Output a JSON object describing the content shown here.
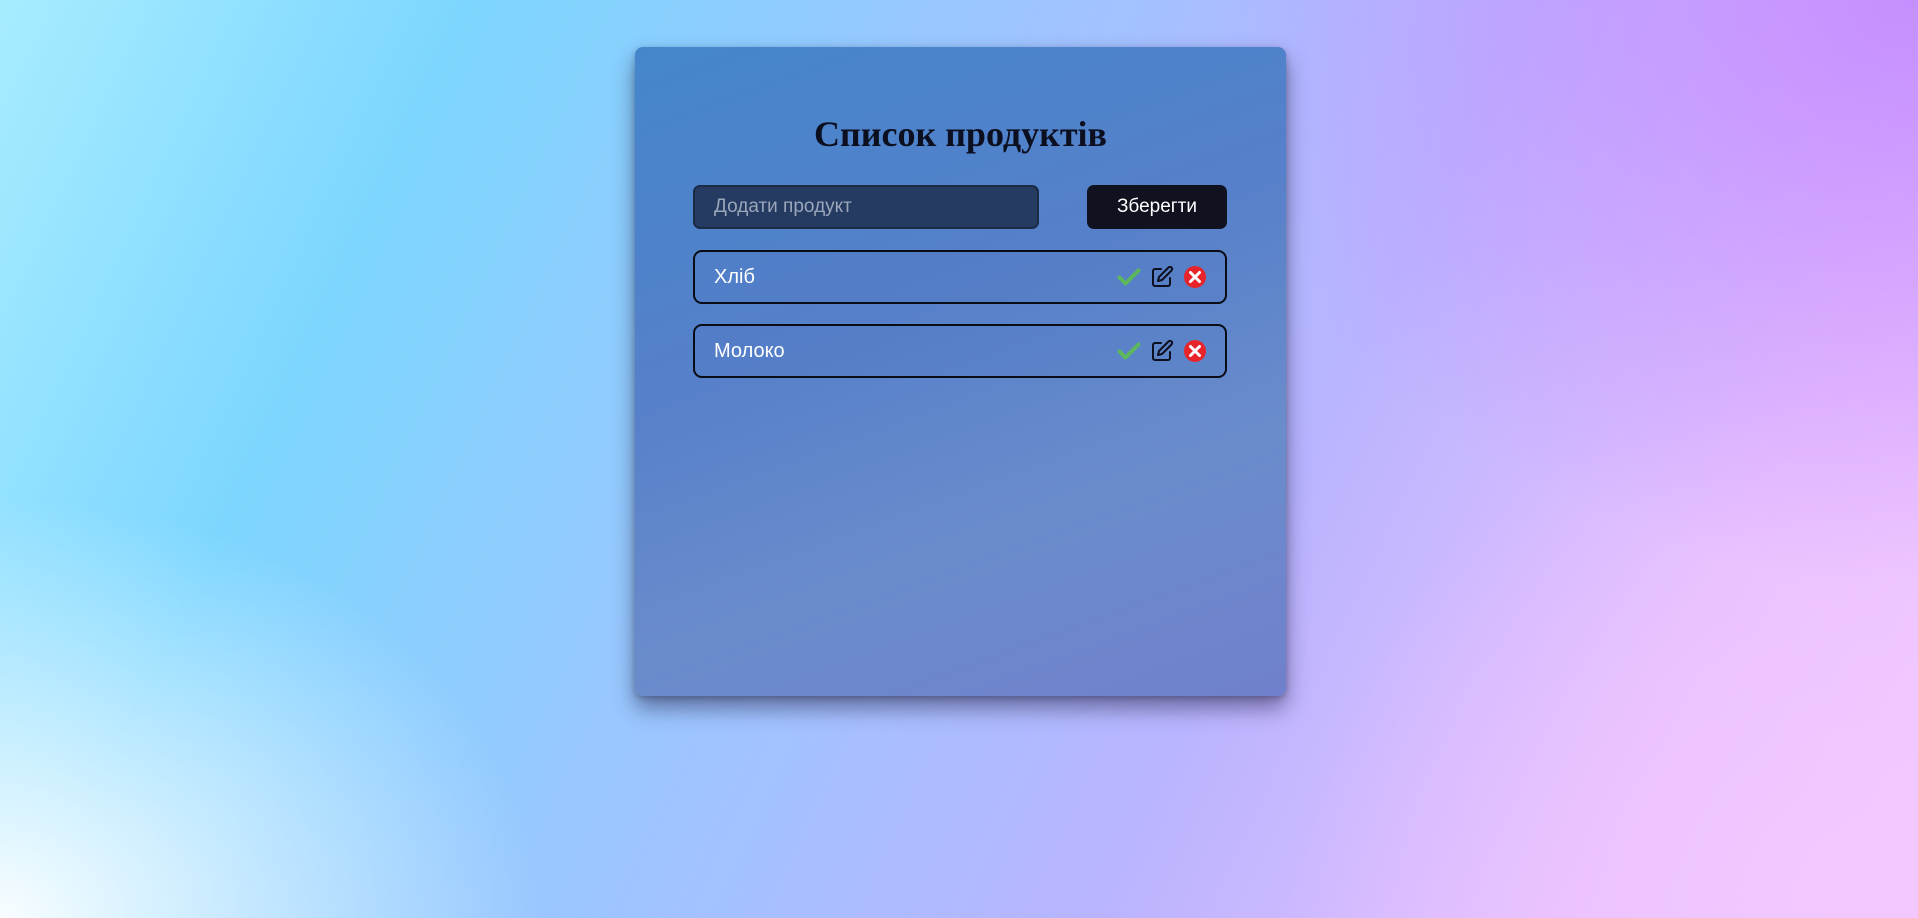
{
  "app": {
    "title": "Список продуктів"
  },
  "form": {
    "placeholder": "Додати продукт",
    "value": "",
    "save_label": "Зберегти"
  },
  "items": [
    {
      "label": "Хліб",
      "actions": [
        "check-icon",
        "edit-icon",
        "delete-icon"
      ]
    },
    {
      "label": "Молоко",
      "actions": [
        "check-icon",
        "edit-icon",
        "delete-icon"
      ]
    }
  ],
  "colors": {
    "check": "#5cb85c",
    "delete": "#e8242b",
    "button_bg": "#10131f",
    "title": "#0c0f1f"
  }
}
